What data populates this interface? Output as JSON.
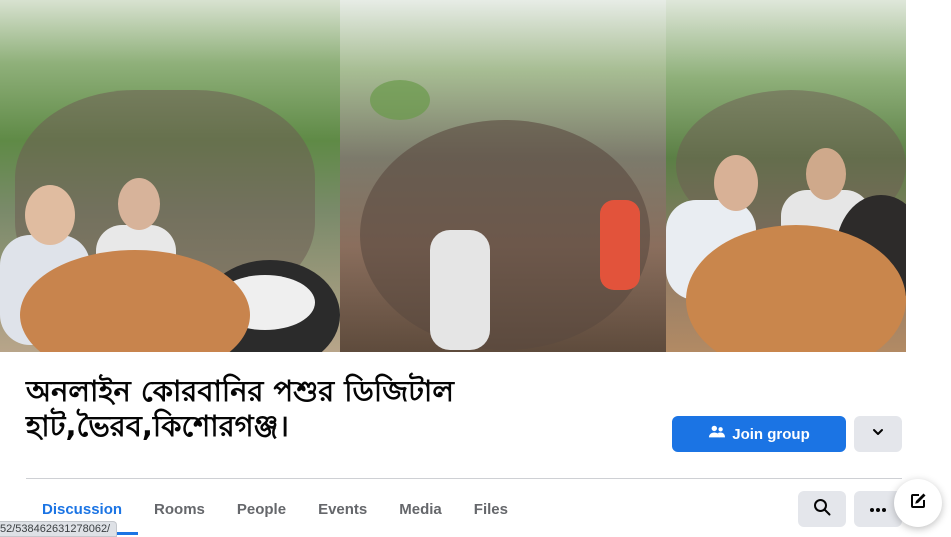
{
  "group": {
    "title": "অনলাইন কোরবানির পশুর ডিজিটাল হাট,ভৈরব,কিশোরগঞ্জ।"
  },
  "actions": {
    "join_label": "Join group",
    "join_icon": "people-icon",
    "dropdown_icon": "chevron-down-icon"
  },
  "tabs": [
    {
      "label": "Discussion",
      "active": true
    },
    {
      "label": "Rooms"
    },
    {
      "label": "People"
    },
    {
      "label": "Events"
    },
    {
      "label": "Media"
    },
    {
      "label": "Files"
    }
  ],
  "toolbar": {
    "search_icon": "search-icon",
    "more_icon": "more-icon",
    "compose_icon": "compose-icon"
  },
  "status_bar": {
    "url": "52/538462631278062/"
  },
  "colors": {
    "primary": "#1b74e4",
    "button_gray": "#e4e6eb",
    "text": "#050505",
    "muted": "#65676b"
  }
}
